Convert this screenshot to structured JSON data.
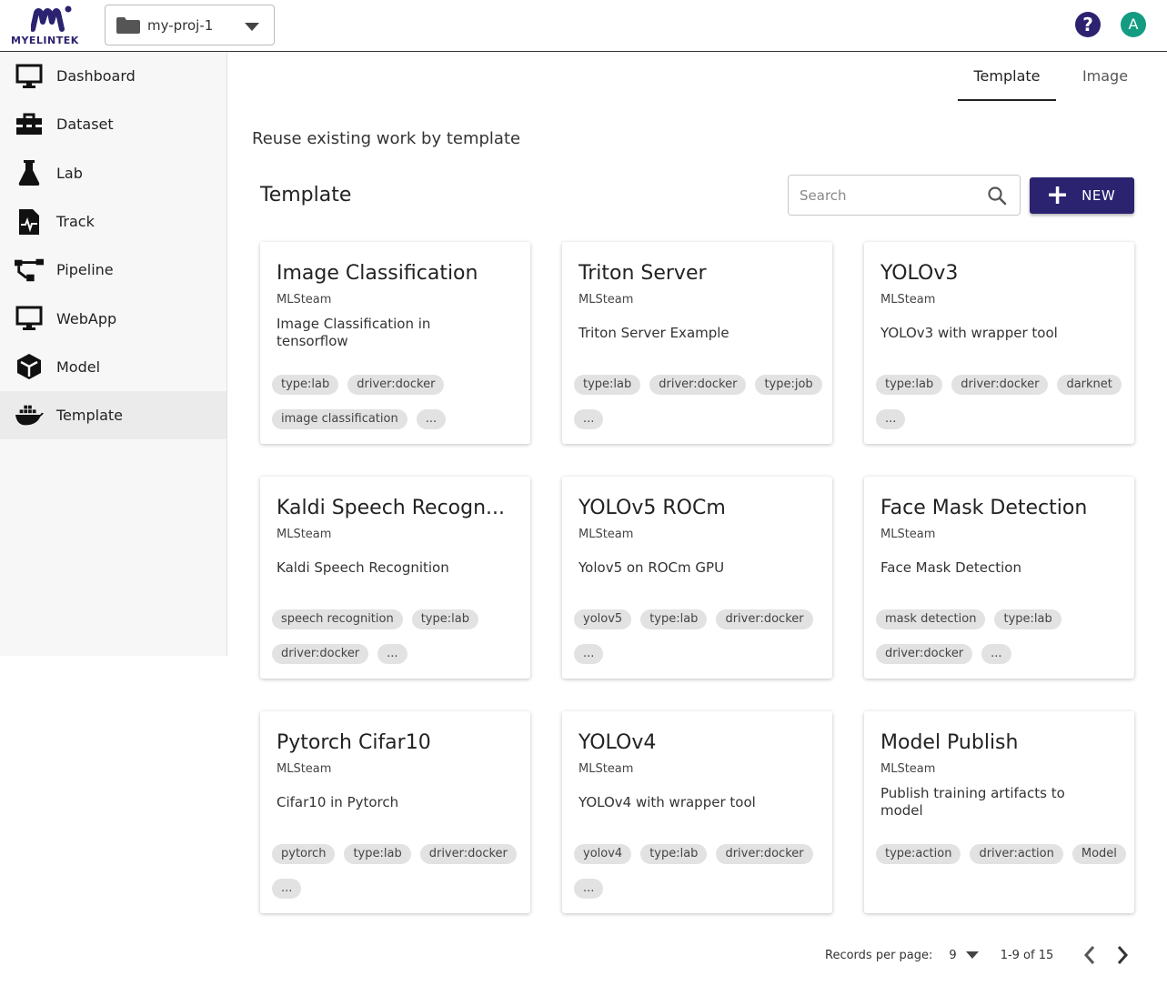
{
  "header": {
    "logo_text": "MYELINTEK",
    "project": "my-proj-1",
    "help_icon": "question-circle-icon",
    "avatar_initial": "A",
    "avatar_color": "#139c82",
    "brand_color": "#2b2370"
  },
  "sidebar": {
    "items": [
      {
        "label": "Dashboard",
        "icon": "monitor-icon"
      },
      {
        "label": "Dataset",
        "icon": "toolbox-icon"
      },
      {
        "label": "Lab",
        "icon": "flask-icon"
      },
      {
        "label": "Track",
        "icon": "file-pulse-icon"
      },
      {
        "label": "Pipeline",
        "icon": "pipeline-icon"
      },
      {
        "label": "WebApp",
        "icon": "monitor-icon"
      },
      {
        "label": "Model",
        "icon": "cube-icon"
      },
      {
        "label": "Template",
        "icon": "docker-icon",
        "active": true
      }
    ]
  },
  "tabs": [
    {
      "label": "Template",
      "active": true
    },
    {
      "label": "Image",
      "active": false
    }
  ],
  "main": {
    "subtitle": "Reuse existing work by template",
    "section_title": "Template",
    "search_placeholder": "Search",
    "new_button": "NEW"
  },
  "cards": [
    {
      "title": "Image Classification",
      "owner": "MLSteam",
      "description": "Image Classification in tensorflow",
      "tags": [
        "type:lab",
        "driver:docker",
        "image classification",
        "..."
      ]
    },
    {
      "title": "Triton Server",
      "owner": "MLSteam",
      "description": "Triton Server Example",
      "tags": [
        "type:lab",
        "driver:docker",
        "type:job",
        "..."
      ]
    },
    {
      "title": "YOLOv3",
      "owner": "MLSteam",
      "description": "YOLOv3 with wrapper tool",
      "tags": [
        "type:lab",
        "driver:docker",
        "darknet",
        "..."
      ]
    },
    {
      "title": "Kaldi Speech Recogn...",
      "owner": "MLSteam",
      "description": "Kaldi Speech Recognition",
      "tags": [
        "speech recognition",
        "type:lab",
        "driver:docker",
        "..."
      ]
    },
    {
      "title": "YOLOv5 ROCm",
      "owner": "MLSteam",
      "description": "Yolov5 on ROCm GPU",
      "tags": [
        "yolov5",
        "type:lab",
        "driver:docker",
        "..."
      ]
    },
    {
      "title": "Face Mask Detection",
      "owner": "MLSteam",
      "description": "Face Mask Detection",
      "tags": [
        "mask detection",
        "type:lab",
        "driver:docker",
        "..."
      ]
    },
    {
      "title": "Pytorch Cifar10",
      "owner": "MLSteam",
      "description": "Cifar10 in Pytorch",
      "tags": [
        "pytorch",
        "type:lab",
        "driver:docker",
        "..."
      ]
    },
    {
      "title": "YOLOv4",
      "owner": "MLSteam",
      "description": "YOLOv4 with wrapper tool",
      "tags": [
        "yolov4",
        "type:lab",
        "driver:docker",
        "..."
      ]
    },
    {
      "title": "Model Publish",
      "owner": "MLSteam",
      "description": "Publish training artifacts to model",
      "tags": [
        "type:action",
        "driver:action",
        "Model"
      ]
    }
  ],
  "pagination": {
    "records_per_page_label": "Records per page:",
    "records_per_page": "9",
    "range": "1-9 of 15"
  }
}
